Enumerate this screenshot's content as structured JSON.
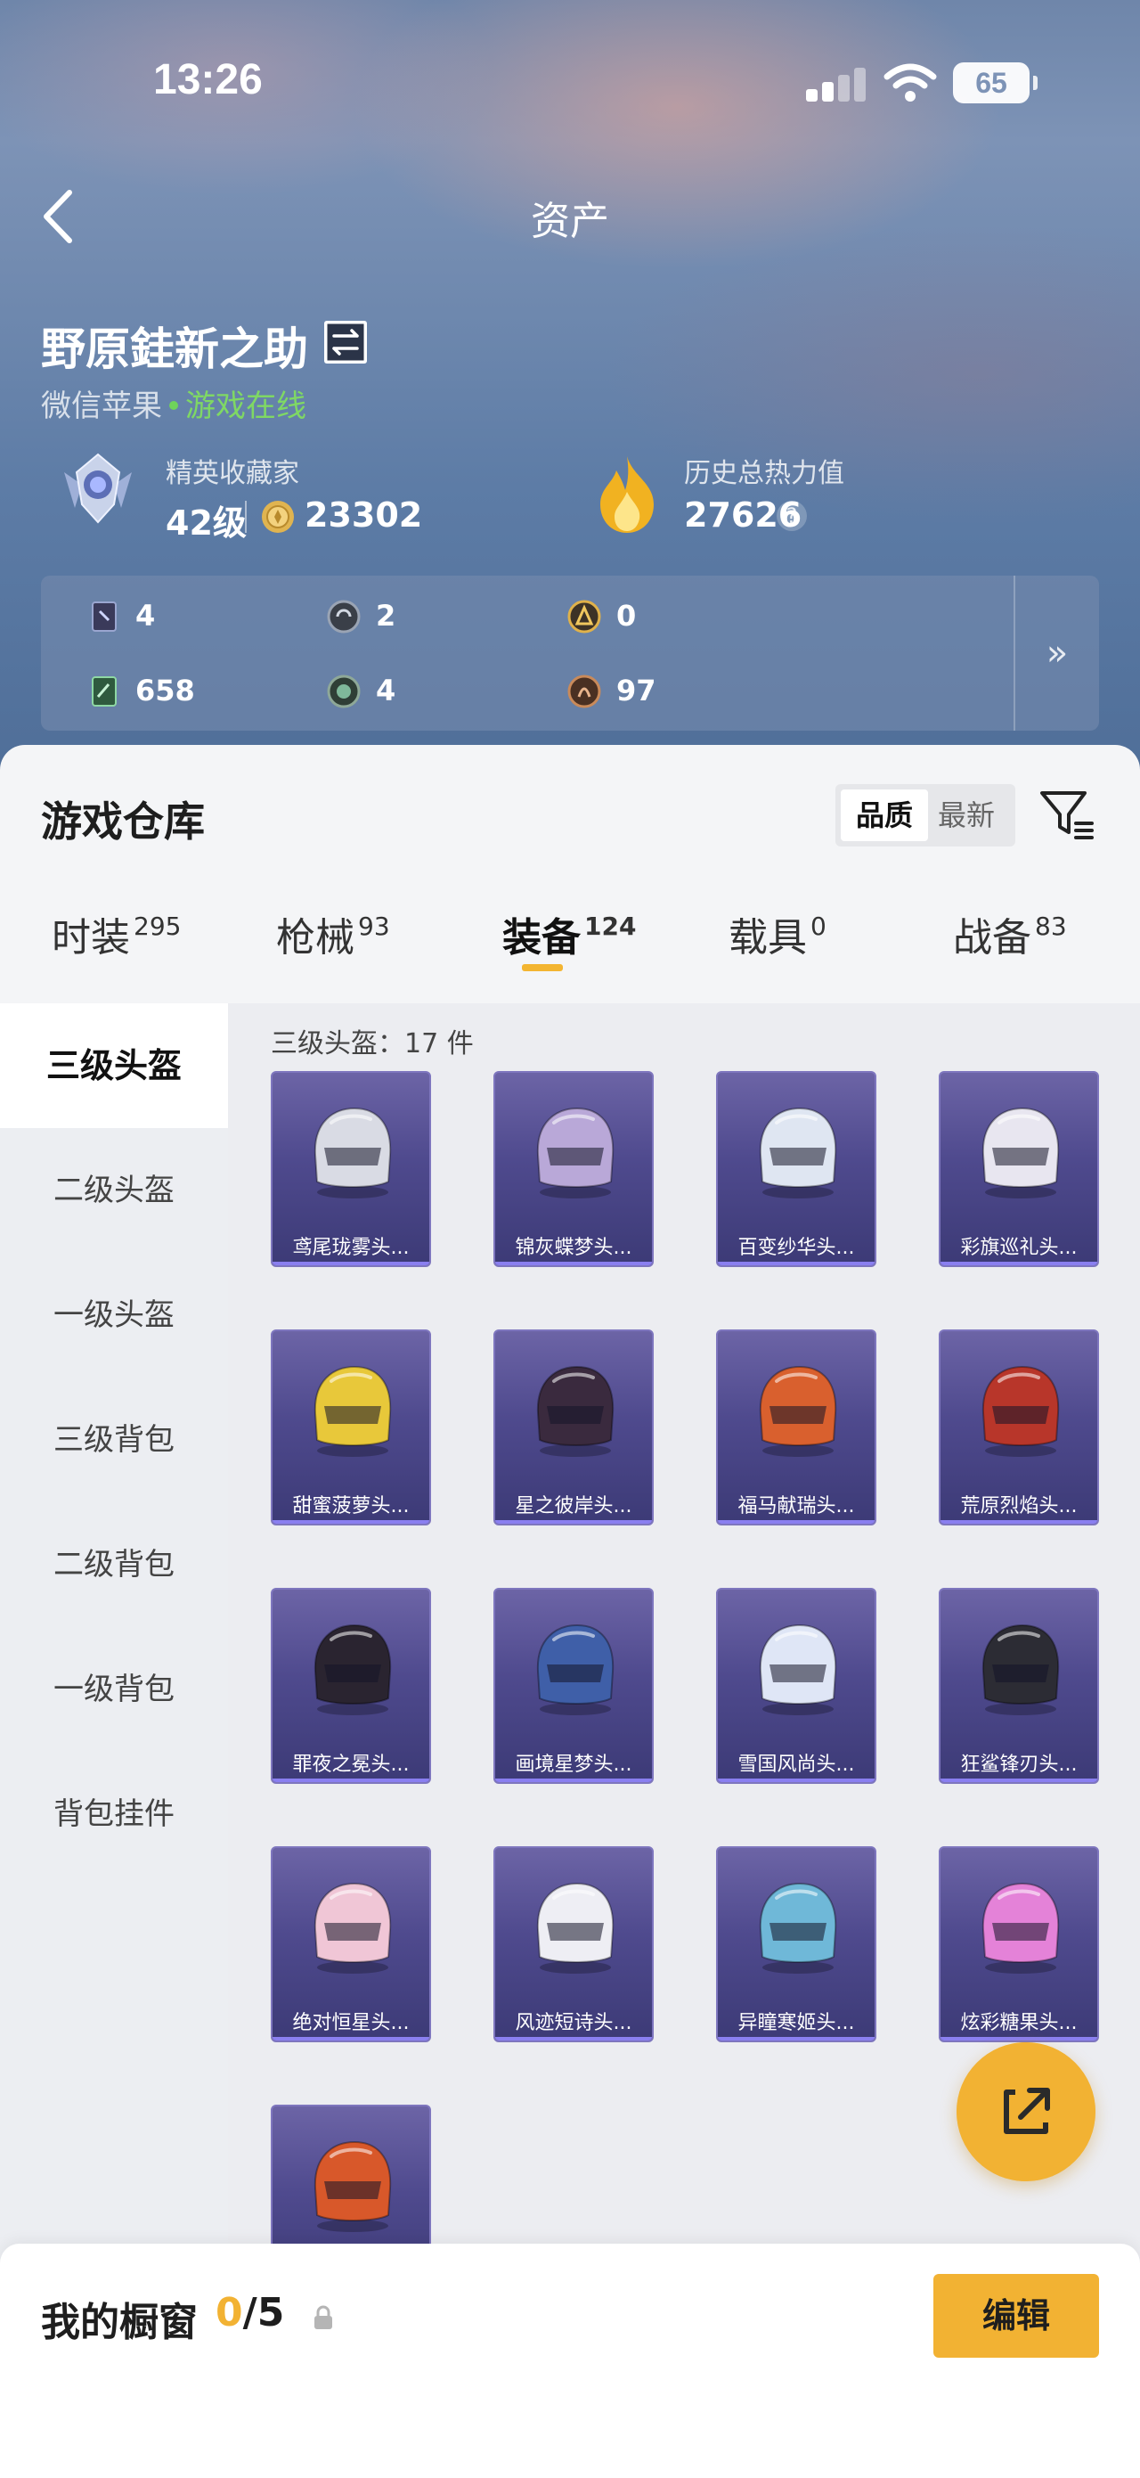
{
  "status_bar": {
    "time": "13:26",
    "battery": "65"
  },
  "header": {
    "title": "资产"
  },
  "player": {
    "name": "野原銈新之助",
    "platform": "微信苹果",
    "online_status": "游戏在线",
    "rank_title": "精英收藏家",
    "rank_level": "42级",
    "coins": "23302",
    "heat_label": "历史总热力值",
    "heat_value": "27626",
    "help": "?"
  },
  "stats": [
    {
      "icon": "card-icon",
      "value": "4"
    },
    {
      "icon": "badge-icon",
      "value": "2"
    },
    {
      "icon": "gold-token-icon",
      "value": "0"
    },
    {
      "icon": "green-card-icon",
      "value": "658"
    },
    {
      "icon": "orb-icon",
      "value": "4"
    },
    {
      "icon": "bronze-token-icon",
      "value": "97"
    }
  ],
  "stats_more": "»",
  "warehouse": {
    "title": "游戏仓库",
    "sort_options": [
      "品质",
      "最新"
    ],
    "tabs": [
      {
        "label": "时装",
        "count": "295"
      },
      {
        "label": "枪械",
        "count": "93"
      },
      {
        "label": "装备",
        "count": "124"
      },
      {
        "label": "载具",
        "count": "0"
      },
      {
        "label": "战备",
        "count": "83"
      }
    ],
    "sidebar": [
      "三级头盔",
      "二级头盔",
      "一级头盔",
      "三级背包",
      "二级背包",
      "一级背包",
      "背包挂件"
    ],
    "category_count": "三级头盔：17 件",
    "items": [
      {
        "name": "鸢尾珑雾头...",
        "color": "#d9dbe4"
      },
      {
        "name": "锦灰蝶梦头...",
        "color": "#b9a8d8"
      },
      {
        "name": "百变纱华头...",
        "color": "#dfe6f2"
      },
      {
        "name": "彩旗巡礼头...",
        "color": "#e8e6f0"
      },
      {
        "name": "甜蜜菠萝头...",
        "color": "#e8c83a"
      },
      {
        "name": "星之彼岸头...",
        "color": "#3a2a3e"
      },
      {
        "name": "福马献瑞头...",
        "color": "#d9602e"
      },
      {
        "name": "荒原烈焰头...",
        "color": "#b8362a"
      },
      {
        "name": "罪夜之冕头...",
        "color": "#2a2430"
      },
      {
        "name": "画境星梦头...",
        "color": "#3f5fa8"
      },
      {
        "name": "雪国风尚头...",
        "color": "#dfe6f6"
      },
      {
        "name": "狂鲨锋刃头...",
        "color": "#2c2c34"
      },
      {
        "name": "绝对恒星头...",
        "color": "#f0c6d6"
      },
      {
        "name": "风迹短诗头...",
        "color": "#eeeef4"
      },
      {
        "name": "异瞳寒姬头...",
        "color": "#6fb8d8"
      },
      {
        "name": "炫彩糖果头...",
        "color": "#e482d8"
      },
      {
        "name": "",
        "color": "#d8582a"
      }
    ]
  },
  "vitrine": {
    "title": "我的橱窗",
    "used": "0",
    "total": "/5",
    "edit": "编辑"
  },
  "colors": {
    "accent": "#f2b233",
    "item_bg": "#4f4a8e",
    "online": "#7fd864"
  }
}
